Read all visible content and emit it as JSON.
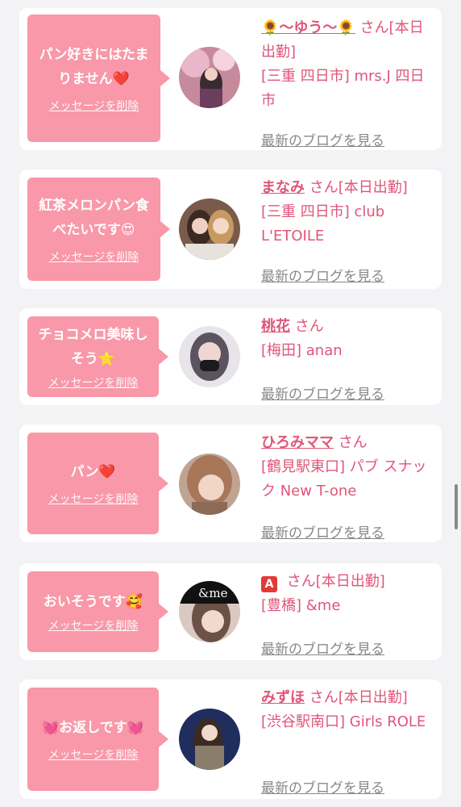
{
  "cards": [
    {
      "message": "パン好きにはたまりません❤️",
      "delete_label": "メッセージを削除",
      "name": "🌻〜ゆう〜🌻",
      "san": "さん[本日出勤]",
      "shop": "[三重 四日市] mrs.J 四日市",
      "blog_label": "最新のブログを見る"
    },
    {
      "message": "紅茶メロンパン食べたいです😍",
      "delete_label": "メッセージを削除",
      "name": "まなみ",
      "san": "さん[本日出勤]",
      "shop": "[三重 四日市] club L'ETOILE",
      "blog_label": "最新のブログを見る"
    },
    {
      "message": "チョコメロ美味しそう⭐",
      "delete_label": "メッセージを削除",
      "name": "桃花",
      "san": "さん",
      "shop": "[梅田] anan",
      "blog_label": "最新のブログを見る"
    },
    {
      "message": "パン❤️",
      "delete_label": "メッセージを削除",
      "name": "ひろみママ",
      "san": "さん",
      "shop": "[鶴見駅東口] パブ スナック New T-one",
      "blog_label": "最新のブログを見る"
    },
    {
      "message": "おいそうです🥰",
      "delete_label": "メッセージを削除",
      "name": "A",
      "san": "さん[本日出勤]",
      "shop": "[豊橋] &me",
      "blog_label": "最新のブログを見る"
    },
    {
      "message": "💓お返しです💓",
      "delete_label": "メッセージを削除",
      "name": "みずほ",
      "san": "さん[本日出勤]",
      "shop": "[渋谷駅南口] Girls ROLE",
      "blog_label": "最新のブログを見る"
    }
  ],
  "avatar_overlays": {
    "card5": "&me"
  }
}
